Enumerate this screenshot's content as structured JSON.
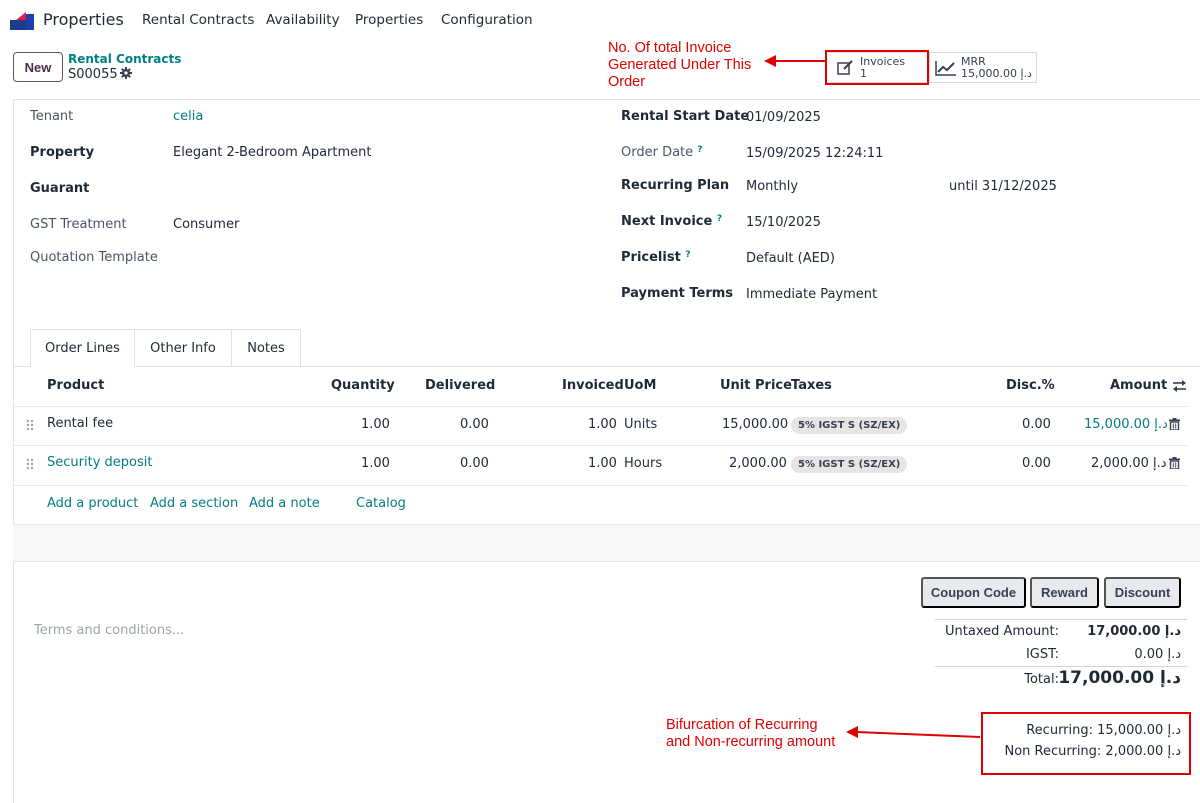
{
  "app": {
    "name": "Properties"
  },
  "menu": [
    "Rental Contracts",
    "Availability",
    "Properties",
    "Configuration"
  ],
  "control": {
    "new_label": "New",
    "breadcrumb_parent": "Rental Contracts",
    "record_name": "S00055"
  },
  "stats": {
    "invoices_label": "Invoices",
    "invoices_count": "1",
    "mrr_label": "MRR",
    "mrr_value": "15,000.00 د.إ"
  },
  "annotations": {
    "invoice_note": [
      "No. Of total Invoice",
      "Generated Under This",
      "Order"
    ],
    "recurring_note": [
      "Bifurcation of Recurring",
      "and Non-recurring amount"
    ],
    "color": "#e00000"
  },
  "form": {
    "left": [
      {
        "label": "Tenant",
        "value": "celia"
      },
      {
        "label": "Property",
        "value": "Elegant 2-Bedroom Apartment"
      },
      {
        "label": "Guarant",
        "value": ""
      },
      {
        "label": "GST Treatment",
        "value": "Consumer"
      },
      {
        "label": "Quotation Template",
        "value": ""
      }
    ],
    "right": [
      {
        "label": "Rental Start Date",
        "value": "01/09/2025"
      },
      {
        "label": "Order Date",
        "value": "15/09/2025 12:24:11"
      },
      {
        "label": "Recurring Plan",
        "value": "Monthly",
        "extra": "until 31/12/2025"
      },
      {
        "label": "Next Invoice",
        "value": "15/10/2025"
      },
      {
        "label": "Pricelist",
        "value": "Default (AED)"
      },
      {
        "label": "Payment Terms",
        "value": "Immediate Payment"
      }
    ],
    "help_mark": "?"
  },
  "tabs": [
    "Order Lines",
    "Other Info",
    "Notes"
  ],
  "table": {
    "headers": [
      "Product",
      "Quantity",
      "Delivered",
      "Invoiced",
      "UoM",
      "Unit Price",
      "Taxes",
      "Disc.%",
      "Amount"
    ],
    "rows": [
      {
        "product": "Rental fee",
        "quantity": "1.00",
        "delivered": "0.00",
        "invoiced": "1.00",
        "uom": "Units",
        "unit_price": "15,000.00",
        "taxes": "5% IGST S (SZ/EX)",
        "disc": "0.00",
        "amount": "15,000.00 د.إ"
      },
      {
        "product": "Security deposit",
        "quantity": "1.00",
        "delivered": "0.00",
        "invoiced": "1.00",
        "uom": "Hours",
        "unit_price": "2,000.00",
        "taxes": "5% IGST S (SZ/EX)",
        "disc": "0.00",
        "amount": "2,000.00 د.إ"
      }
    ],
    "add_links": [
      "Add a product",
      "Add a section",
      "Add a note",
      "Catalog"
    ]
  },
  "actions": [
    "Coupon Code",
    "Reward",
    "Discount"
  ],
  "terms_placeholder": "Terms and conditions...",
  "totals": {
    "untaxed_label": "Untaxed Amount:",
    "untaxed_value": "17,000.00 د.إ",
    "igst_label": "IGST:",
    "igst_value": "0.00 د.إ",
    "total_label": "Total:",
    "total_value": "17,000.00 د.إ"
  },
  "recurring": {
    "recurring": "Recurring: 15,000.00 د.إ",
    "non_recurring": "Non Recurring: 2,000.00 د.إ"
  }
}
